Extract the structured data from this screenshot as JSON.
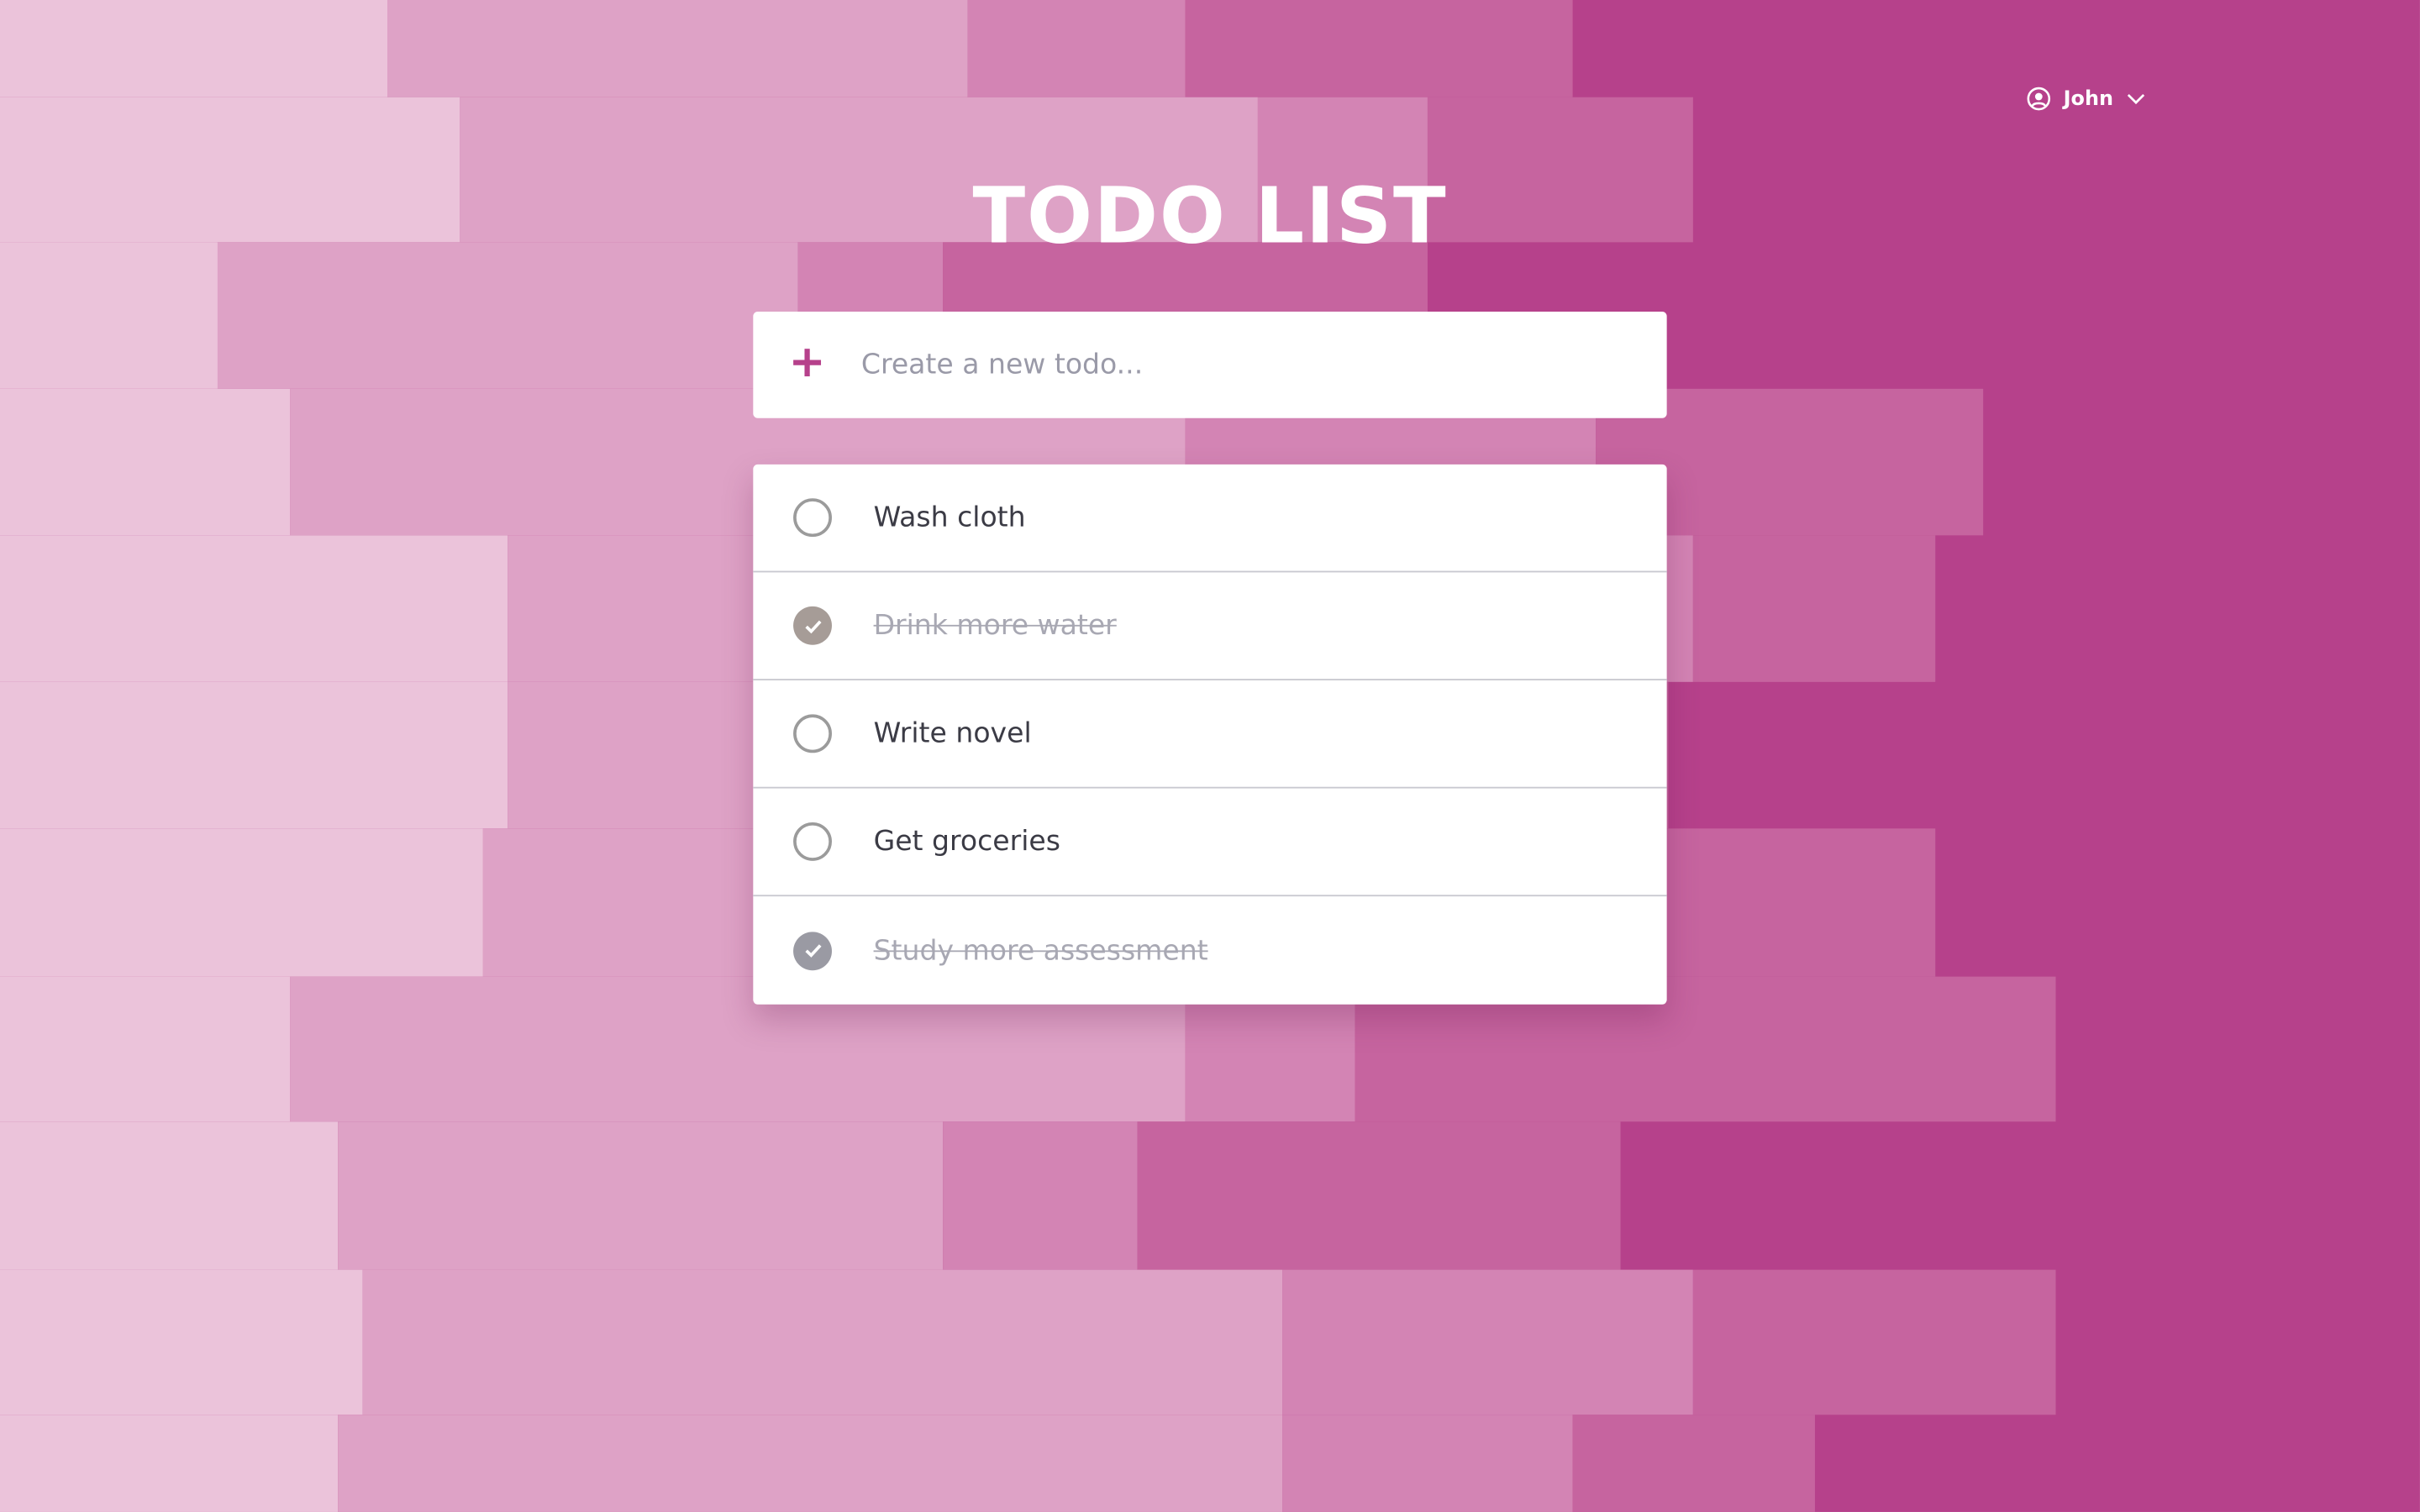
{
  "header": {
    "title": "TODO LIST",
    "user_name": "John"
  },
  "new_todo": {
    "placeholder": "Create a new todo..."
  },
  "todos": [
    {
      "label": "Wash cloth",
      "completed": false
    },
    {
      "label": "Drink more water",
      "completed": true,
      "check_color": "#a69c97"
    },
    {
      "label": "Write novel",
      "completed": false
    },
    {
      "label": "Get groceries",
      "completed": false
    },
    {
      "label": "Study more assessment",
      "completed": true,
      "check_color": "#9a9aa3"
    }
  ],
  "colors": {
    "accent": "#b6418b",
    "background_tones": [
      "#ebc3da",
      "#dea2c6",
      "#d384b4",
      "#c6649f",
      "#b6418b"
    ]
  },
  "icons": {
    "user": "user-circle-icon",
    "dropdown": "chevron-down-icon",
    "add": "plus-icon",
    "check": "checkmark-icon"
  }
}
